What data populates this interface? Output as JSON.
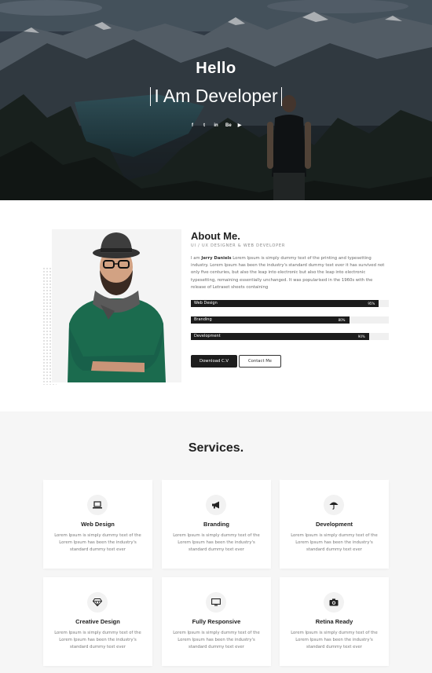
{
  "hero": {
    "greeting": "Hello",
    "prefix": "I Am",
    "role": "Developer",
    "socials": [
      {
        "icon": "facebook-icon",
        "glyph": "f"
      },
      {
        "icon": "twitter-icon",
        "glyph": "t"
      },
      {
        "icon": "linkedin-icon",
        "glyph": "in"
      },
      {
        "icon": "behance-icon",
        "glyph": "Be"
      },
      {
        "icon": "youtube-icon",
        "glyph": "▶"
      }
    ]
  },
  "about": {
    "title": "About Me.",
    "subtitle": "UI / UX Designer & Web Developer",
    "intro": "I am",
    "name": "Jerry Daniels",
    "paragraph": "Lorem Ipsum is simply dummy text of the printing and typesetting industry. Lorem Ipsum has been the industry's standard dummy text ever it has survived not only five centuries, but also the leap into electronic but also the leap into electronic typesetting, remaining essentially unchanged. It was popularised in the 1960s with the release of Letraset sheets containing",
    "skills": [
      {
        "name": "Web Design",
        "percent": 95,
        "label": "95%"
      },
      {
        "name": "Branding",
        "percent": 80,
        "label": "80%"
      },
      {
        "name": "Development",
        "percent": 90,
        "label": "90%"
      }
    ],
    "download_label": "Download C.V",
    "contact_label": "Contact Me"
  },
  "services": {
    "title": "Services.",
    "items": [
      {
        "title": "Web Design",
        "icon": "laptop-icon",
        "desc": "Lorem Ipsum is simply dummy text of the Lorem Ipsum has been the industry's standard dummy text ever"
      },
      {
        "title": "Branding",
        "icon": "megaphone-icon",
        "desc": "Lorem Ipsum is simply dummy text of the Lorem Ipsum has been the industry's standard dummy text ever"
      },
      {
        "title": "Development",
        "icon": "umbrella-icon",
        "desc": "Lorem Ipsum is simply dummy text of the Lorem Ipsum has been the industry's standard dummy text ever"
      },
      {
        "title": "Creative Design",
        "icon": "diamond-icon",
        "desc": "Lorem Ipsum is simply dummy text of the Lorem Ipsum has been the industry's standard dummy text ever"
      },
      {
        "title": "Fully Responsive",
        "icon": "monitor-icon",
        "desc": "Lorem Ipsum is simply dummy text of the Lorem Ipsum has been the industry's standard dummy text ever"
      },
      {
        "title": "Retina Ready",
        "icon": "camera-icon",
        "desc": "Lorem Ipsum is simply dummy text of the Lorem Ipsum has been the industry's standard dummy text ever"
      }
    ]
  }
}
